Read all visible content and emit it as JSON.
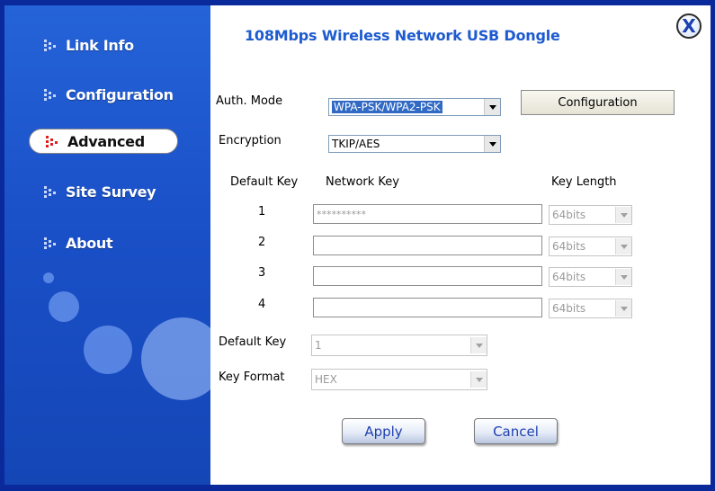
{
  "window": {
    "title": "108Mbps Wireless Network USB Dongle",
    "close_label": "X"
  },
  "sidebar": {
    "items": [
      {
        "label": "Link Info"
      },
      {
        "label": "Configuration"
      },
      {
        "label": "Advanced",
        "active": true
      },
      {
        "label": "Site Survey"
      },
      {
        "label": "About"
      }
    ]
  },
  "form": {
    "auth_mode_label": "Auth. Mode",
    "auth_mode_value": "WPA-PSK/WPA2-PSK",
    "configuration_button": "Configuration",
    "encryption_label": "Encryption",
    "encryption_value": "TKIP/AES",
    "headers": {
      "default_key": "Default Key",
      "network_key": "Network Key",
      "key_length": "Key Length"
    },
    "keys": [
      {
        "index": "1",
        "value": "**********",
        "length": "64bits"
      },
      {
        "index": "2",
        "value": "",
        "length": "64bits"
      },
      {
        "index": "3",
        "value": "",
        "length": "64bits"
      },
      {
        "index": "4",
        "value": "",
        "length": "64bits"
      }
    ],
    "default_key_label": "Default Key",
    "default_key_value": "1",
    "key_format_label": "Key Format",
    "key_format_value": "HEX",
    "apply_button": "Apply",
    "cancel_button": "Cancel"
  }
}
